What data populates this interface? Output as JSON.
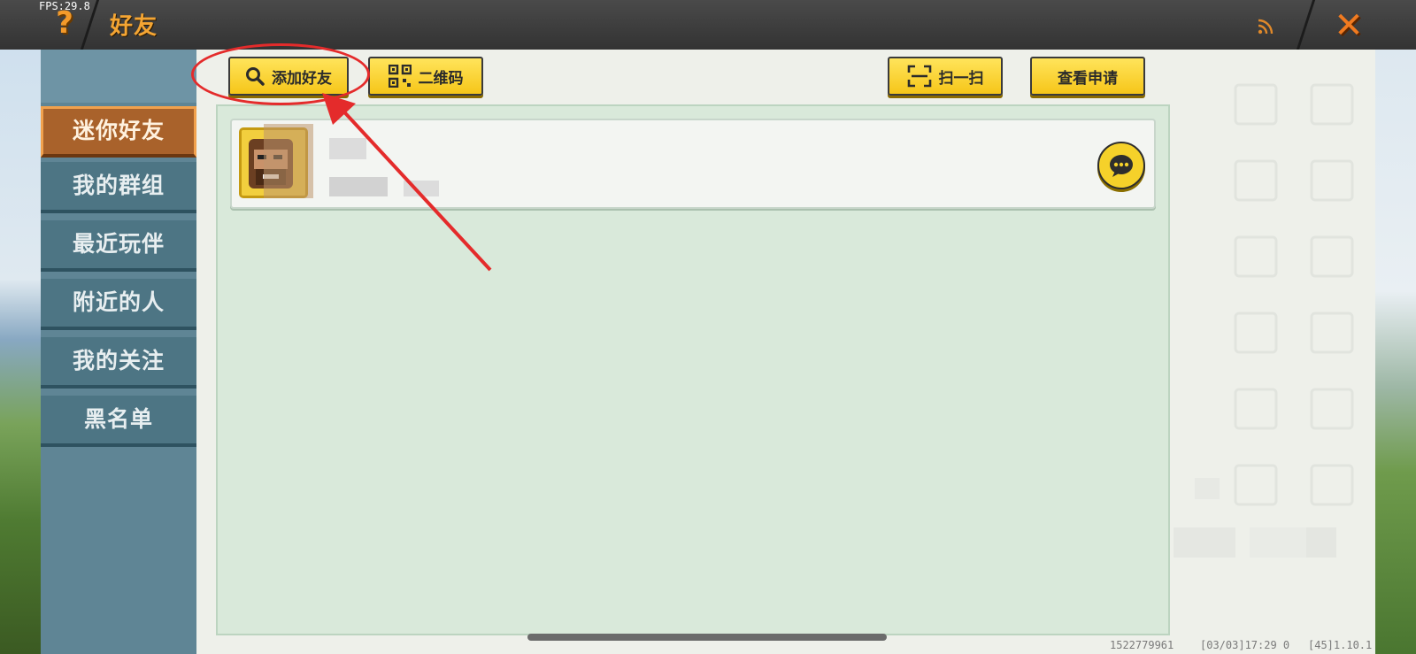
{
  "topbar": {
    "fps": "FPS:29.8",
    "help_icon": "help-question-icon",
    "title": "好友",
    "signal_icon": "signal-icon",
    "close_icon": "close-x-icon"
  },
  "toolbar": {
    "add_friend": "添加好友",
    "qr_code": "二维码",
    "scan": "扫一扫",
    "view_requests": "查看申请"
  },
  "sidebar": {
    "items": [
      {
        "label": "迷你好友",
        "active": true
      },
      {
        "label": "我的群组",
        "active": false
      },
      {
        "label": "最近玩伴",
        "active": false
      },
      {
        "label": "附近的人",
        "active": false
      },
      {
        "label": "我的关注",
        "active": false
      },
      {
        "label": "黑名单",
        "active": false
      }
    ]
  },
  "friend_list": {
    "friends": [
      {
        "avatar_icon": "character-avatar-icon",
        "chat_icon": "chat-bubble-icon"
      }
    ]
  },
  "footer": {
    "uid": "1522779961",
    "datetime": "[03/03]17:29 0",
    "version": "[45]1.10.1"
  },
  "colors": {
    "accent_yellow": "#f6c619",
    "tab_active": "#a9622b",
    "tab_inactive": "#4d7584",
    "annotation_red": "#e42b2b"
  }
}
